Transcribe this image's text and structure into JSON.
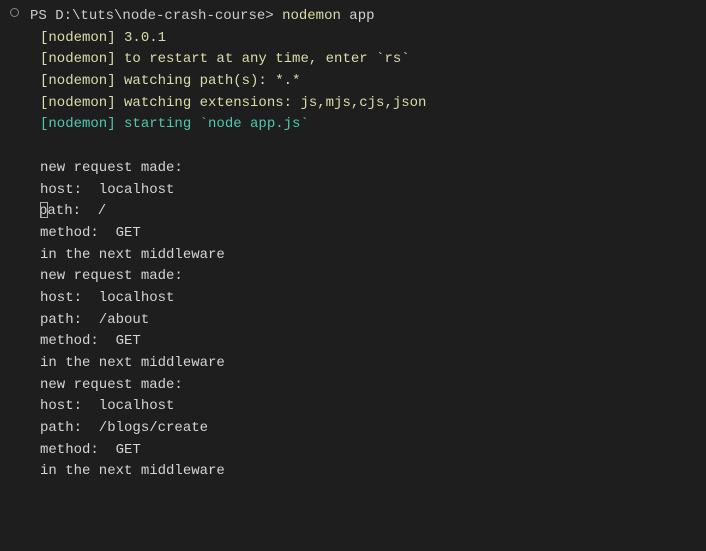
{
  "prompt": {
    "prefix": "PS ",
    "path": "D:\\tuts\\node-crash-course",
    "symbol": "> ",
    "command": "nodemon",
    "arg": " app"
  },
  "nodemon": {
    "line1": "[nodemon] 3.0.1",
    "line2": "[nodemon] to restart at any time, enter `rs`",
    "line3": "[nodemon] watching path(s): *.*",
    "line4": "[nodemon] watching extensions: js,mjs,cjs,json",
    "line5": "[nodemon] starting `node app.js`"
  },
  "output": {
    "req1": {
      "l1": "new request made:",
      "l2": "host:  localhost",
      "l3": "path:  /",
      "l4": "method:  GET",
      "l5": "in the next middleware"
    },
    "req2": {
      "l1": "new request made:",
      "l2": "host:  localhost",
      "l3": "path:  /about",
      "l4": "method:  GET",
      "l5": "in the next middleware"
    },
    "req3": {
      "l1": "new request made:",
      "l2": "host:  localhost",
      "l3": "path:  /blogs/create",
      "l4": "method:  GET",
      "l5": "in the next middleware"
    }
  }
}
